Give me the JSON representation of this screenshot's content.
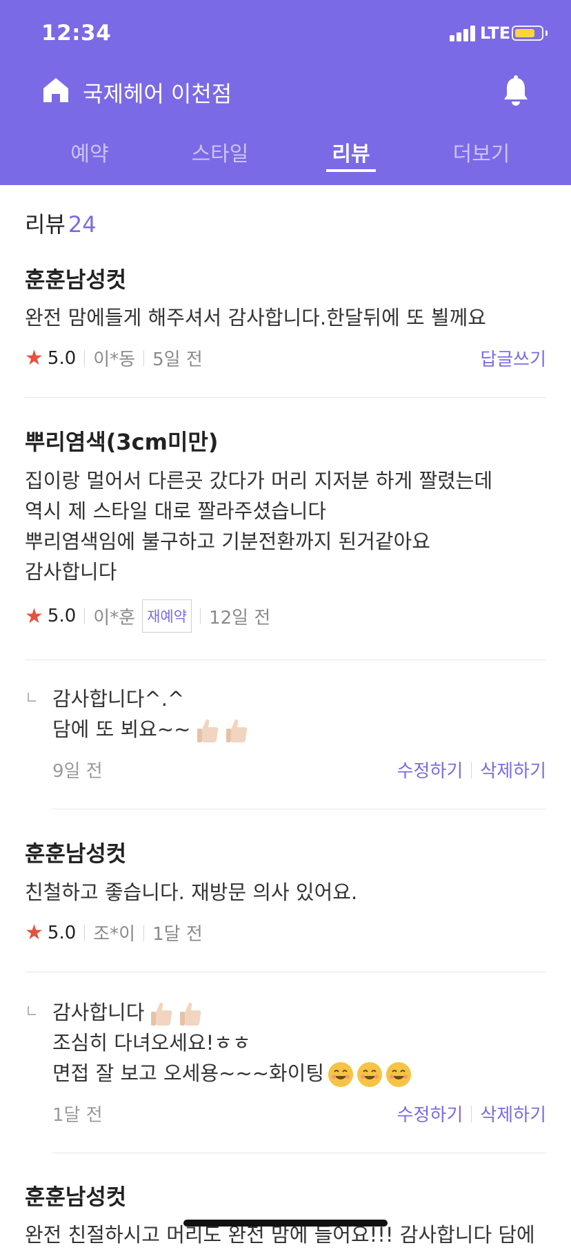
{
  "status_bar": {
    "time": "12:34",
    "network": "LTE"
  },
  "header": {
    "shop_name": "국제헤어 이천점"
  },
  "tabs": [
    {
      "label": "예약"
    },
    {
      "label": "스타일"
    },
    {
      "label": "리뷰"
    },
    {
      "label": "더보기"
    }
  ],
  "active_tab": "리뷰",
  "review_section": {
    "heading": "리뷰",
    "count": "24"
  },
  "reviews": [
    {
      "title": "훈훈남성컷",
      "lines": [
        "완전 맘에들게 해주셔서 감사합니다.한달뒤에 또 뵐께요"
      ],
      "rating": "5.0",
      "author": "이*동",
      "date": "5일 전",
      "reply_link": "답글쓰기"
    },
    {
      "title": "뿌리염색(3cm미만)",
      "lines": [
        "집이랑 멀어서 다른곳 갔다가 머리 지저분 하게 짤렸는데",
        "역시 제 스타일 대로 짤라주셨습니다",
        "뿌리염색임에 불구하고 기분전환까지 된거같아요",
        "감사합니다"
      ],
      "rating": "5.0",
      "author": "이*훈",
      "badge": "재예약",
      "date": "12일 전",
      "reply": {
        "lines": [
          "감사합니다^.^",
          "담에 또 뵈요~~"
        ],
        "date": "9일 전",
        "edit": "수정하기",
        "delete": "삭제하기"
      }
    },
    {
      "title": "훈훈남성컷",
      "lines": [
        "친철하고 좋습니다. 재방문 의사 있어요."
      ],
      "rating": "5.0",
      "author": "조*이",
      "date": "1달 전",
      "reply": {
        "lines": [
          "감사합니다",
          "조심히 다녀오세요!ㅎㅎ",
          "면접 잘 보고 오세용~~~화이팅"
        ],
        "date": "1달 전",
        "edit": "수정하기",
        "delete": "삭제하기"
      }
    },
    {
      "title": "훈훈남성컷",
      "lines": [
        "완전 친절하시고 머리도 완전 맘에 들어요!!! 감사합니다 담에"
      ]
    }
  ],
  "colors": {
    "accent": "#7b6ae6",
    "star": "#e8503e",
    "battery": "#ffd43b"
  },
  "icons": [
    "home-icon",
    "bell-icon",
    "star-icon",
    "thumbs-up-icon",
    "smile-emoji-icon",
    "reply-indicator-icon"
  ]
}
